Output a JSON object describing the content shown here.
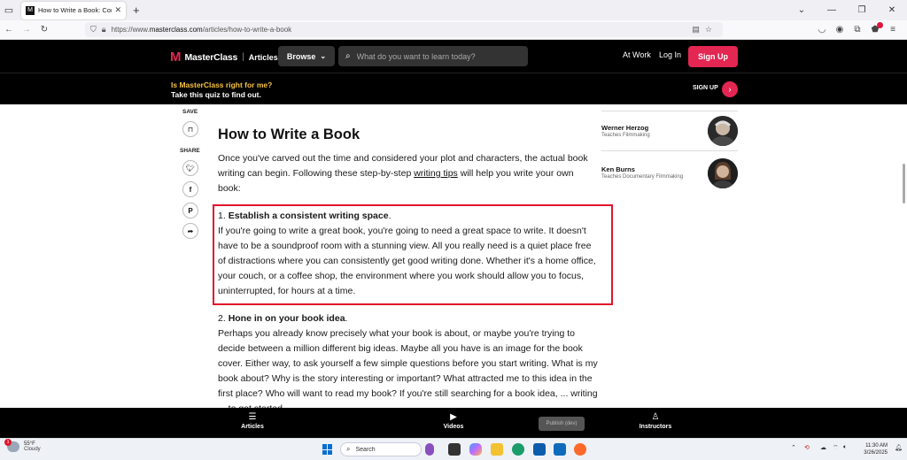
{
  "browser": {
    "tab_title": "How to Write a Book: Complete",
    "url_prefix": "https://www.",
    "url_domain": "masterclass.com",
    "url_path": "/articles/how-to-write-a-book"
  },
  "header": {
    "logo_text": "MasterClass",
    "section": "Articles",
    "browse_label": "Browse",
    "search_placeholder": "What do you want to learn today?",
    "at_work": "At Work",
    "log_in": "Log In",
    "sign_up": "Sign Up"
  },
  "promo": {
    "line1": "Is MasterClass right for me?",
    "line2": "Take this quiz to find out.",
    "cta": "SIGN UP"
  },
  "share": {
    "save_label": "SAVE",
    "share_label": "SHARE"
  },
  "article": {
    "title": "How to Write a Book",
    "intro_before": "Once you've carved out the time and considered your plot and characters, the actual book writing can begin. Following these step-by-step ",
    "intro_link": "writing tips",
    "intro_after": " will help you write your own book:",
    "step1_num": "1. ",
    "step1_title": "Establish a consistent writing space",
    "step1_dot": ".",
    "step1_body": "If you're going to write a great book, you're going to need a great space to write. It doesn't have to be a soundproof room with a stunning view. All you really need is a quiet place free of distractions where you can consistently get good writing done. Whether it's a home office, your couch, or a coffee shop, the environment where you work should allow you to focus, uninterrupted, for hours at a time.",
    "step2_num": "2. ",
    "step2_title": "Hone in on your book idea",
    "step2_dot": ".",
    "step2_body": "Perhaps you already know precisely what your book is about, or maybe you're trying to decide between a million different big ideas. Maybe all you have is an image for the book cover. Either way, to ask yourself a few simple questions before you start writing. What is my book about? Why is the story interesting or important? What attracted me to this idea in the first place? Who will want to read my book? If you're still searching for a book idea, ... writing ... to get started."
  },
  "instructors": [
    {
      "name": "Werner Herzog",
      "subtitle": "Teaches Filmmaking"
    },
    {
      "name": "Ken Burns",
      "subtitle": "Teaches Documentary Filmmaking"
    }
  ],
  "bottom_nav": {
    "articles": "Articles",
    "videos": "Videos",
    "instructors": "Instructors",
    "publish": "Publish (dev)"
  },
  "taskbar": {
    "weather_temp": "55°F",
    "weather_desc": "Cloudy",
    "weather_badge": "1",
    "search_placeholder": "Search",
    "time": "11:30 AM",
    "date": "3/26/2025"
  }
}
